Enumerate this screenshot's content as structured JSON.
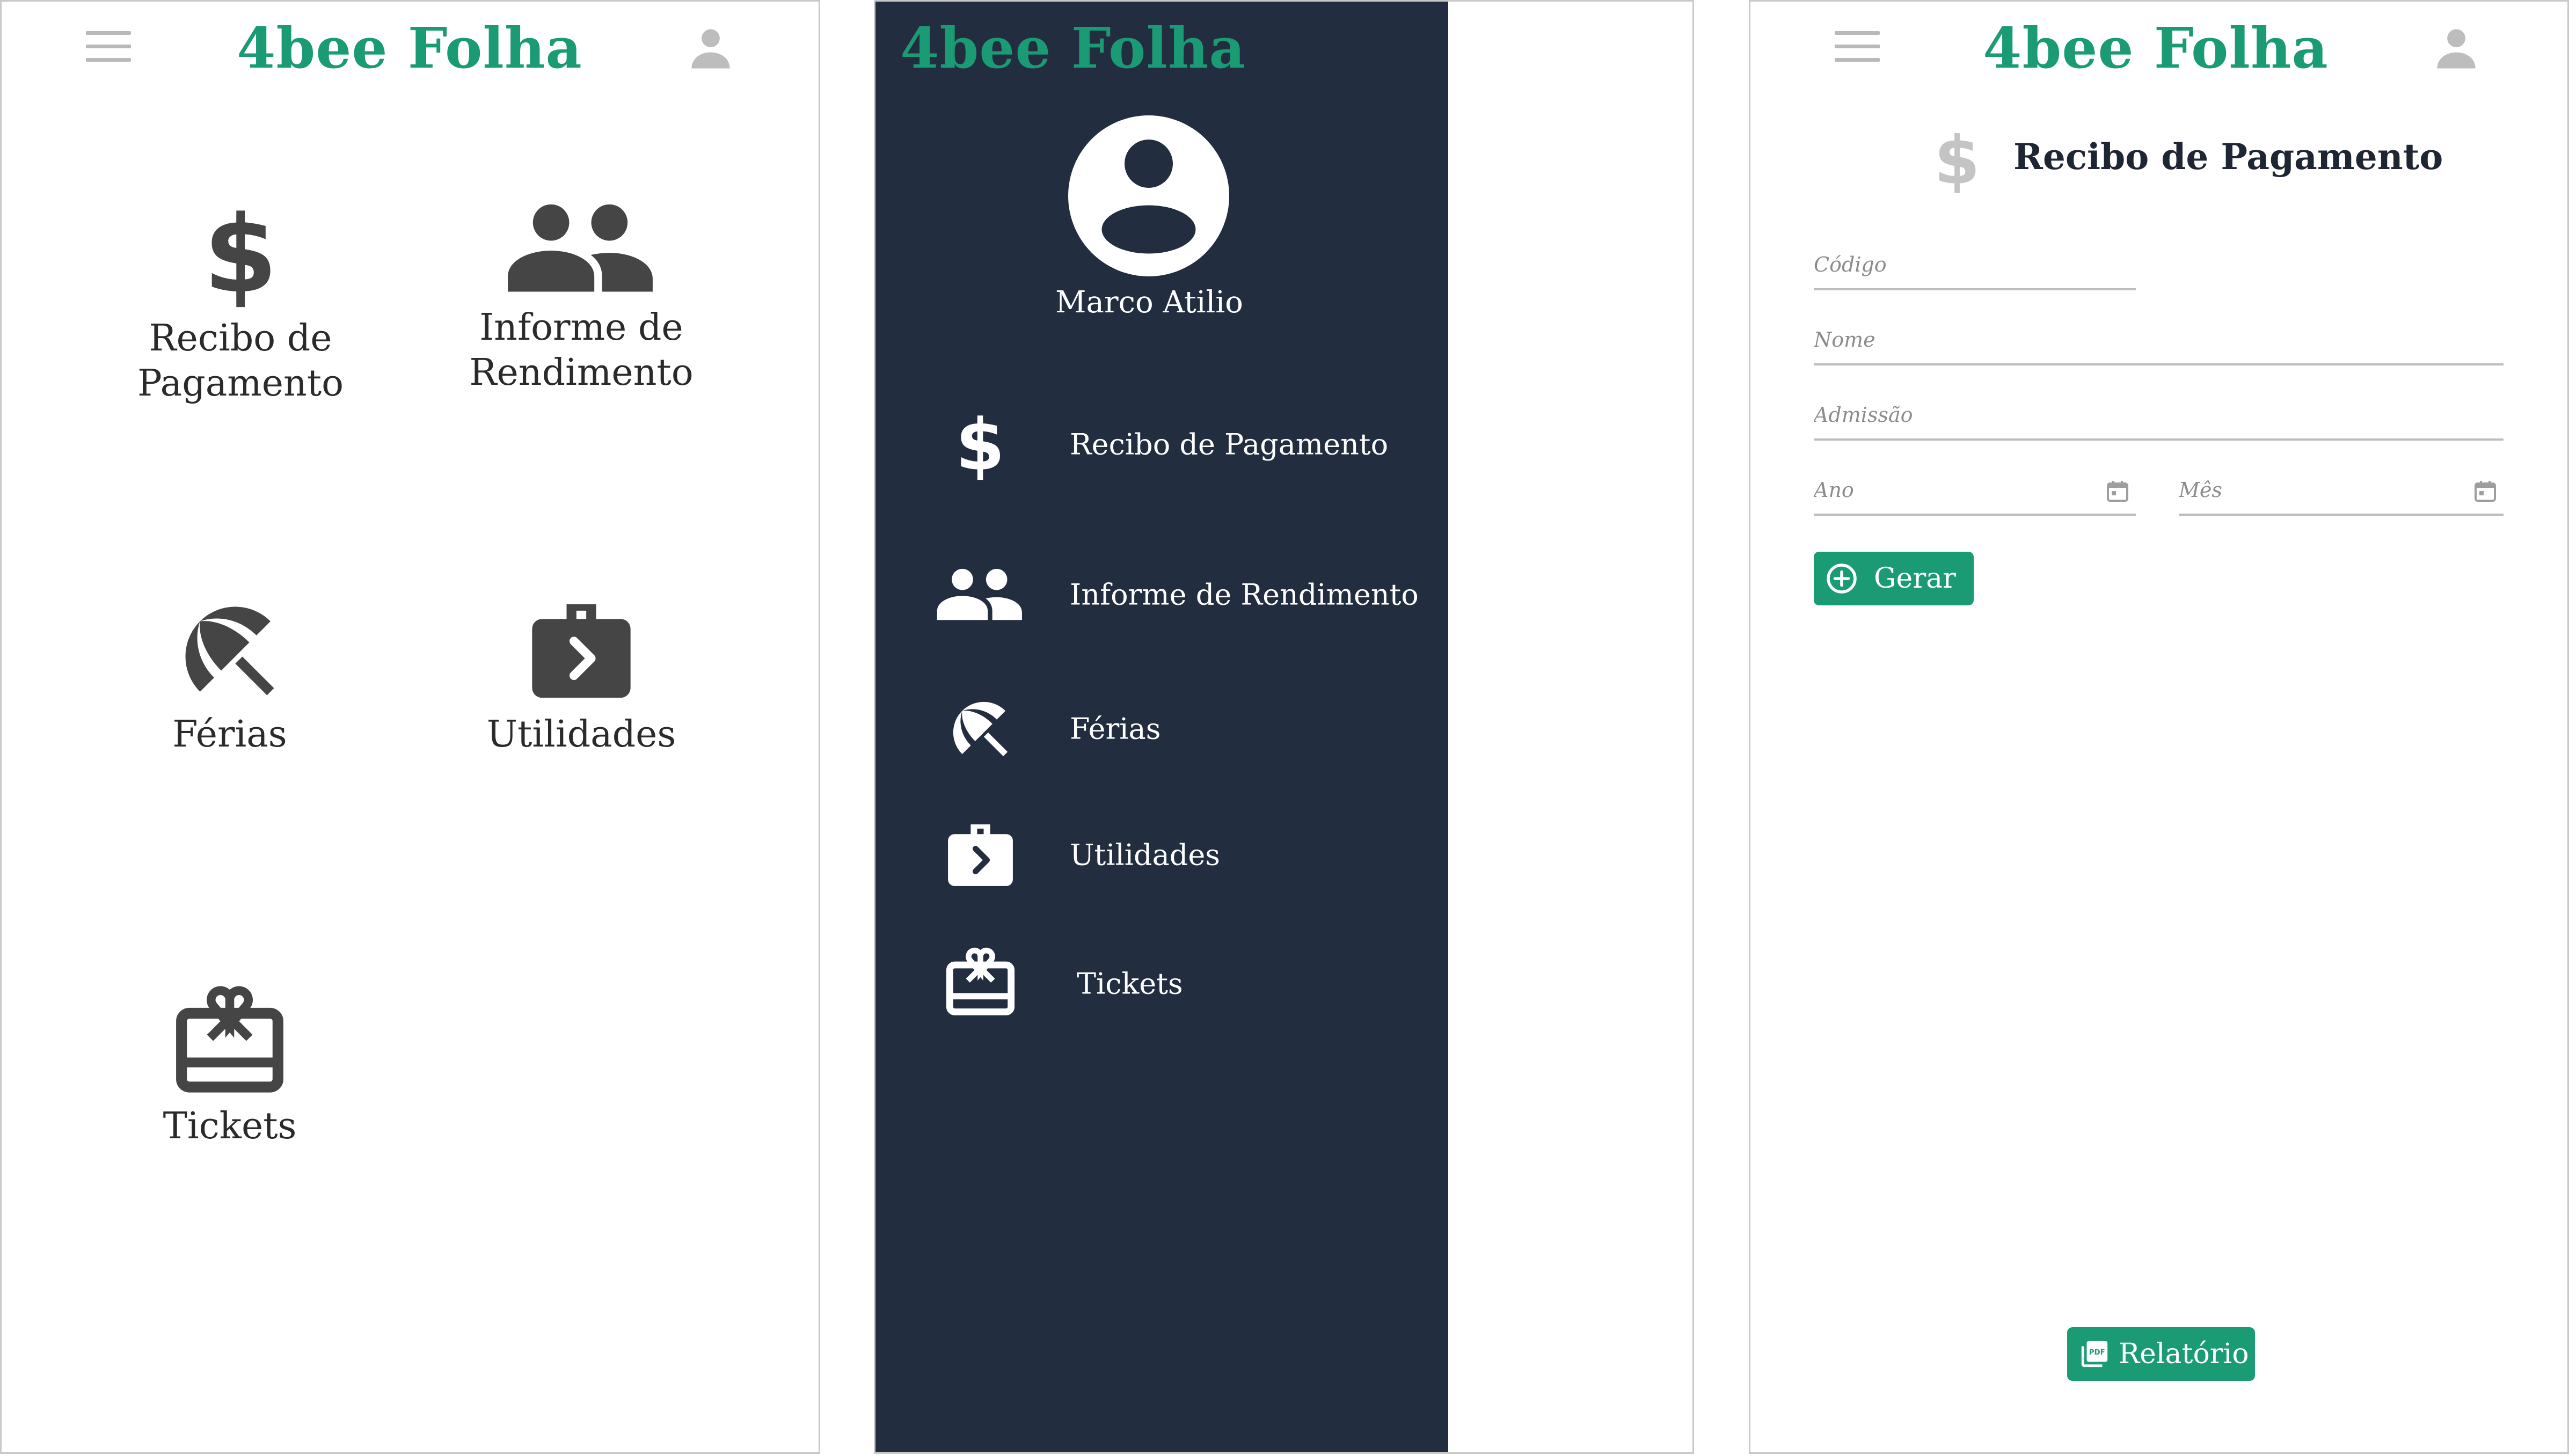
{
  "app": {
    "title": "4bee Folha",
    "brand_color": "#1a9b74",
    "drawer_color": "#232d40"
  },
  "home": {
    "tiles": [
      {
        "label": "Recibo de\nPagamento",
        "icon": "dollar-icon"
      },
      {
        "label": "Informe de\nRendimento",
        "icon": "people-icon"
      },
      {
        "label": "Férias",
        "icon": "beach-umbrella-icon"
      },
      {
        "label": "Utilidades",
        "icon": "briefcase-icon"
      },
      {
        "label": "Tickets",
        "icon": "gift-card-icon"
      }
    ]
  },
  "drawer": {
    "user_name": "Marco Atilio",
    "items": [
      {
        "label": "Recibo de Pagamento",
        "icon": "dollar-icon"
      },
      {
        "label": "Informe de Rendimento",
        "icon": "people-icon"
      },
      {
        "label": "Férias",
        "icon": "beach-umbrella-icon"
      },
      {
        "label": "Utilidades",
        "icon": "briefcase-icon"
      },
      {
        "label": "Tickets",
        "icon": "gift-card-icon"
      }
    ]
  },
  "form": {
    "heading": "Recibo de Pagamento",
    "fields": {
      "codigo": {
        "placeholder": "Código",
        "value": ""
      },
      "nome": {
        "placeholder": "Nome",
        "value": ""
      },
      "admissao": {
        "placeholder": "Admissão",
        "value": ""
      },
      "ano": {
        "placeholder": "Ano",
        "value": ""
      },
      "mes": {
        "placeholder": "Mês",
        "value": ""
      }
    },
    "generate_label": "Gerar",
    "report_label": "Relatório"
  }
}
